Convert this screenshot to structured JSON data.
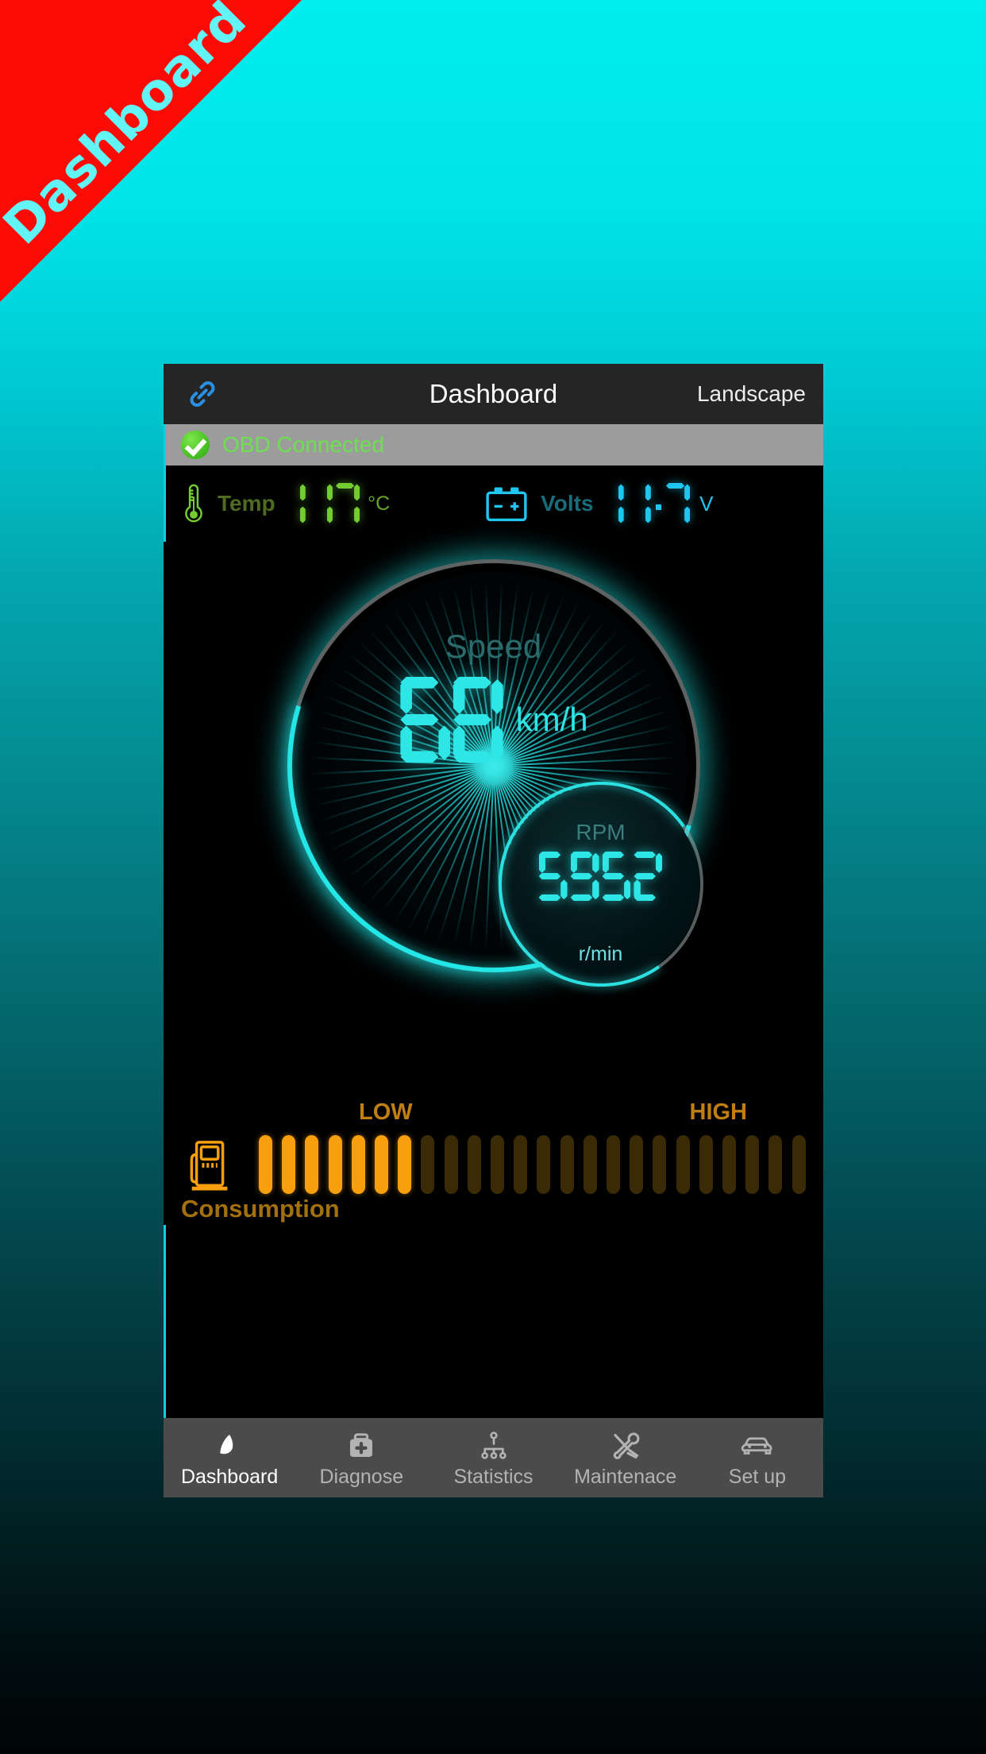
{
  "ribbon": {
    "label": "Dashboard",
    "bg_color": "#fb0a06",
    "text_color": "#63f5f5"
  },
  "appbar": {
    "title": "Dashboard",
    "action_label": "Landscape",
    "link_icon": "link-icon"
  },
  "status": {
    "text": "OBD Connected",
    "icon": "check-circle-icon",
    "text_color": "#6de04f",
    "bar_color": "#9c9c9c"
  },
  "metrics": {
    "temp": {
      "label": "Temp",
      "value": "117",
      "unit": "°C",
      "color": "#74cc33",
      "icon": "thermometer-icon"
    },
    "volts": {
      "label": "Volts",
      "value": "11.7",
      "unit": "V",
      "color": "#20c6ef",
      "icon": "battery-icon"
    }
  },
  "speedometer": {
    "label": "Speed",
    "value": "68",
    "unit": "km/h",
    "accent_color": "#23e6e6",
    "track_color": "#96a0a0"
  },
  "rpm": {
    "label": "RPM",
    "value": "5952",
    "unit": "r/min",
    "accent_color": "#2ae0e0"
  },
  "consumption": {
    "label": "Consumption",
    "low_label": "LOW",
    "high_label": "HIGH",
    "icon": "fuel-pump-icon",
    "total_bars": 24,
    "lit_bars": 7,
    "on_color": "#f79f0d",
    "off_color": "#3a2a06",
    "text_color": "#a3700f"
  },
  "navbar": {
    "items": [
      {
        "label": "Dashboard",
        "icon": "speedometer-icon",
        "active": true
      },
      {
        "label": "Diagnose",
        "icon": "first-aid-kit-icon",
        "active": false
      },
      {
        "label": "Statistics",
        "icon": "hierarchy-chart-icon",
        "active": false
      },
      {
        "label": "Maintenace",
        "icon": "tools-icon",
        "active": false
      },
      {
        "label": "Set up",
        "icon": "car-icon",
        "active": false
      }
    ]
  },
  "chart_data": {
    "type": "bar",
    "title": "Consumption",
    "categories": [
      "LOW",
      "HIGH"
    ],
    "values": [
      7
    ],
    "ylim": [
      0,
      24
    ],
    "grid": false
  }
}
